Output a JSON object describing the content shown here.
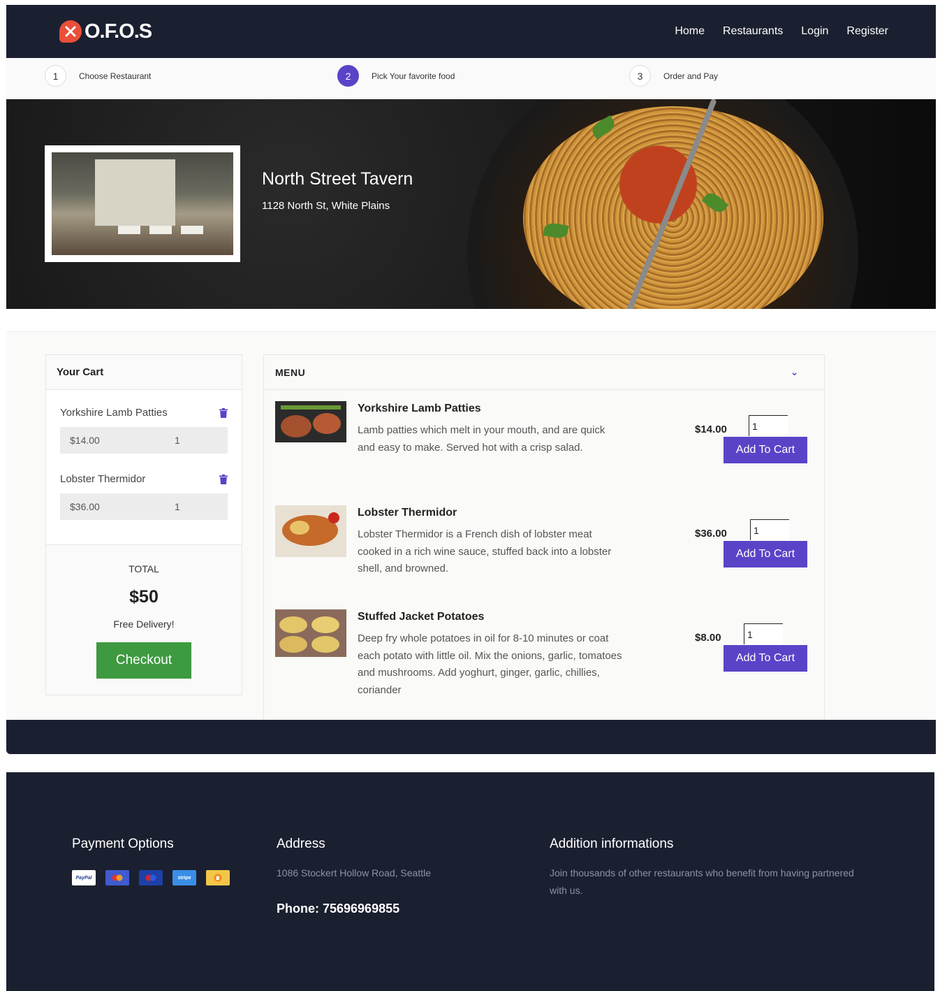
{
  "brand": {
    "logo_text": "O.F.O.S"
  },
  "nav": {
    "items": [
      "Home",
      "Restaurants",
      "Login",
      "Register"
    ]
  },
  "steps": [
    {
      "num": "1",
      "label": "Choose Restaurant"
    },
    {
      "num": "2",
      "label": "Pick Your favorite food"
    },
    {
      "num": "3",
      "label": "Order and Pay"
    }
  ],
  "restaurant": {
    "name": "North Street Tavern",
    "address": "1128 North St, White Plains"
  },
  "cart": {
    "title": "Your Cart",
    "items": [
      {
        "name": "Yorkshire Lamb Patties",
        "price": "$14.00",
        "qty": "1"
      },
      {
        "name": "Lobster Thermidor",
        "price": "$36.00",
        "qty": "1"
      }
    ],
    "total_label": "TOTAL",
    "total_value": "$50",
    "delivery": "Free Delivery!",
    "checkout_label": "Checkout"
  },
  "menu": {
    "title": "MENU",
    "add_label": "Add To Cart",
    "items": [
      {
        "title": "Yorkshire Lamb Patties",
        "desc": "Lamb patties which melt in your mouth, and are quick and easy to make. Served hot with a crisp salad.",
        "price": "$14.00",
        "qty": "1"
      },
      {
        "title": "Lobster Thermidor",
        "desc": "Lobster Thermidor is a French dish of lobster meat cooked in a rich wine sauce, stuffed back into a lobster shell, and browned.",
        "price": "$36.00",
        "qty": "1"
      },
      {
        "title": "Stuffed Jacket Potatoes",
        "desc": "Deep fry whole potatoes in oil for 8-10 minutes or coat each potato with little oil. Mix the onions, garlic, tomatoes and mushrooms. Add yoghurt, ginger, garlic, chillies, coriander",
        "price": "$8.00",
        "qty": "1"
      }
    ]
  },
  "footer": {
    "payment_title": "Payment Options",
    "payment_icons": [
      "PayPal",
      "stripe"
    ],
    "address_title": "Address",
    "address": "1086 Stockert Hollow Road, Seattle",
    "phone": "Phone: 75696969855",
    "info_title": "Addition informations",
    "info": "Join thousands of other restaurants who benefit from having partnered with us."
  },
  "colors": {
    "accent": "#5b43c8",
    "checkout": "#3e9a40",
    "dark": "#1b2030",
    "logo": "#e8503a"
  }
}
